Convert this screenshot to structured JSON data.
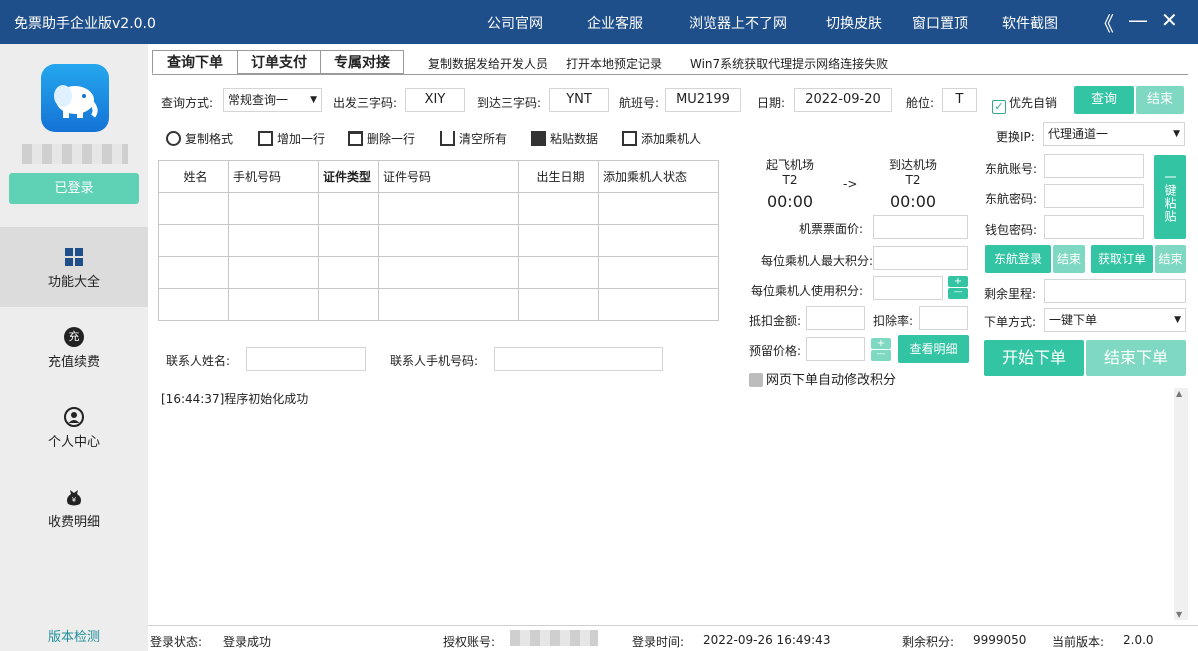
{
  "window": {
    "title": "免票助手企业版v2.0.0",
    "menu": [
      "公司官网",
      "企业客服",
      "浏览器上不了网",
      "切换皮肤",
      "窗口置顶",
      "软件截图"
    ],
    "collapse_icon": "《",
    "minimize_icon": "—",
    "close_icon": "✕"
  },
  "sidebar": {
    "login_button": "已登录",
    "items": [
      {
        "label": "功能大全",
        "icon": "grid-icon"
      },
      {
        "label": "充值续费",
        "icon": "recharge-icon",
        "glyph": "充"
      },
      {
        "label": "个人中心",
        "icon": "user-icon"
      },
      {
        "label": "收费明细",
        "icon": "money-bag-icon"
      }
    ],
    "version_check": "版本检测"
  },
  "tabs": {
    "primary": [
      "查询下单",
      "订单支付",
      "专属对接"
    ],
    "secondary": [
      "复制数据发给开发人员",
      "打开本地预定记录",
      "Win7系统获取代理提示网络连接失败"
    ]
  },
  "query": {
    "mode_label": "查询方式:",
    "mode_value": "常规查询一",
    "from_label": "出发三字码:",
    "from_value": "XIY",
    "to_label": "到达三字码:",
    "to_value": "YNT",
    "flight_label": "航班号:",
    "flight_value": "MU2199",
    "date_label": "日期:",
    "date_value": "2022-09-20",
    "cabin_label": "舱位:",
    "cabin_value": "T",
    "priority_label": "优先自销",
    "query_button": "查询",
    "end_button": "结束"
  },
  "toolbar": {
    "copy_format": "复制格式",
    "add_row": "增加一行",
    "delete_row": "删除一行",
    "clear_all": "清空所有",
    "paste_data": "粘贴数据",
    "add_passenger": "添加乘机人"
  },
  "table": {
    "headers": [
      "姓名",
      "手机号码",
      "证件类型",
      "证件号码",
      "出生日期",
      "添加乘机人状态"
    ],
    "rows": [
      [
        "",
        "",
        "",
        "",
        "",
        ""
      ],
      [
        "",
        "",
        "",
        "",
        "",
        ""
      ],
      [
        "",
        "",
        "",
        "",
        "",
        ""
      ],
      [
        "",
        "",
        "",
        "",
        "",
        ""
      ]
    ]
  },
  "contact": {
    "name_label": "联系人姓名:",
    "phone_label": "联系人手机号码:"
  },
  "log": {
    "lines": [
      "[16:44:37]程序初始化成功"
    ]
  },
  "flight": {
    "dep_title": "起飞机场",
    "dep_terminal": "T2",
    "dep_time": "00:00",
    "arrow": "->",
    "arr_title": "到达机场",
    "arr_terminal": "T2",
    "arr_time": "00:00",
    "fare_label": "机票票面价:",
    "max_points_label": "每位乘机人最大积分:",
    "use_points_label": "每位乘机人使用积分:",
    "deduct_label": "抵扣金额:",
    "rate_label": "扣除率:",
    "reserve_label": "预留价格:",
    "detail_button": "查看明细",
    "auto_modify_label": "网页下单自动修改积分",
    "plus": "+",
    "minus": "—"
  },
  "account": {
    "ip_label": "更换IP:",
    "ip_value": "代理通道一",
    "east_account_label": "东航账号:",
    "east_password_label": "东航密码:",
    "wallet_password_label": "钱包密码:",
    "one_key_paste": "一键粘贴",
    "east_login_button": "东航登录",
    "end_button": "结束",
    "get_order_button": "获取订单",
    "end_button2": "结束",
    "mileage_label": "剩余里程:",
    "order_mode_label": "下单方式:",
    "order_mode_value": "一键下单",
    "start_order_button": "开始下单",
    "end_order_button": "结束下单"
  },
  "status": {
    "login_state_label": "登录状态:",
    "login_state_value": "登录成功",
    "auth_account_label": "授权账号:",
    "login_time_label": "登录时间:",
    "login_time_value": "2022-09-26 16:49:43",
    "points_label": "剩余积分:",
    "points_value": "9999050",
    "version_label": "当前版本:",
    "version_value": "2.0.0"
  },
  "colors": {
    "titlebar": "#1f4f8b",
    "accent": "#33c4a3",
    "accent_light": "#7fd9c2",
    "sidebar": "#ededed"
  }
}
